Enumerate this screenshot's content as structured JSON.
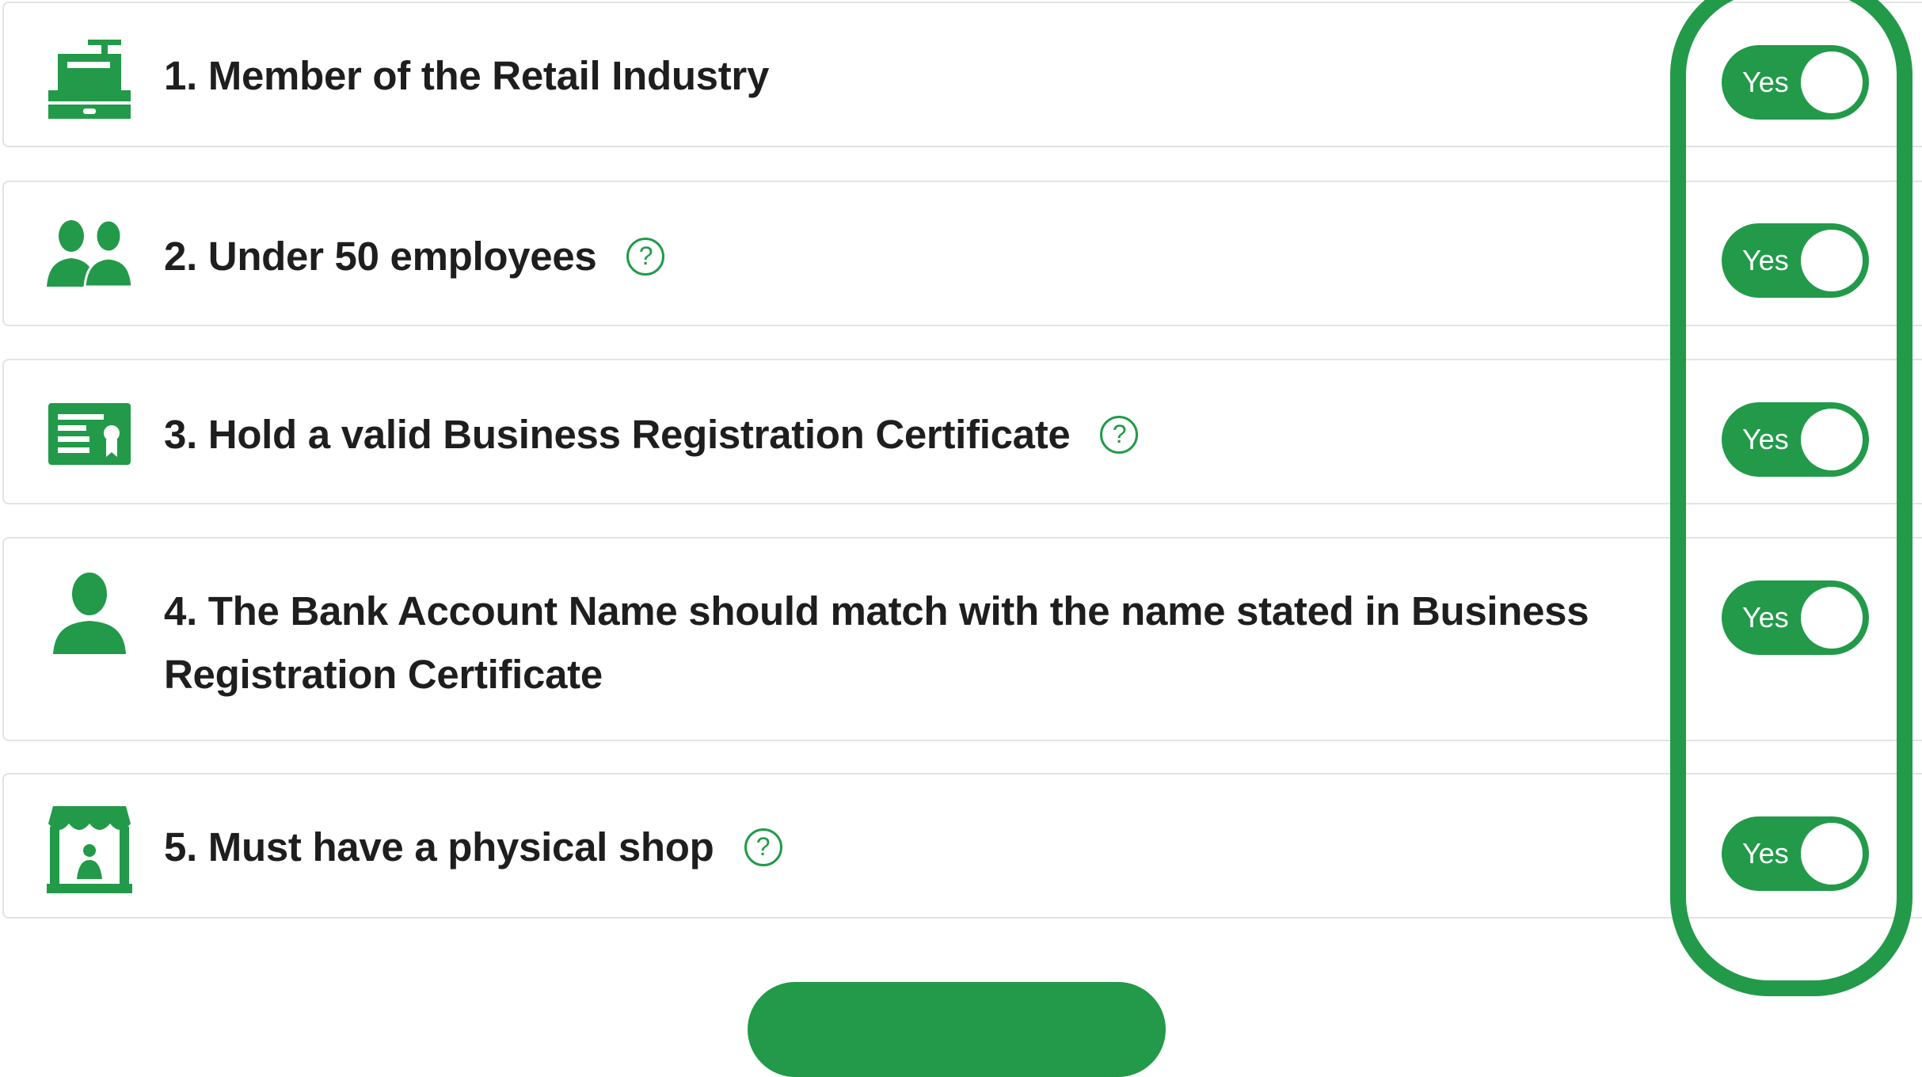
{
  "accent_color": "#229a49",
  "criteria": [
    {
      "icon": "cash-register-icon",
      "text": "1. Member of the Retail Industry",
      "has_help": false,
      "toggle_label": "Yes",
      "toggle_on": true
    },
    {
      "icon": "employees-icon",
      "text": "2. Under 50 employees",
      "has_help": true,
      "toggle_label": "Yes",
      "toggle_on": true
    },
    {
      "icon": "certificate-icon",
      "text": "3. Hold a valid Business Registration Certificate",
      "has_help": true,
      "toggle_label": "Yes",
      "toggle_on": true
    },
    {
      "icon": "person-icon",
      "text": "4. The Bank Account Name should match with the name stated in Business Registration Certificate",
      "text_line1": "4. The Bank Account Name should match with the name stated in Business",
      "text_line2": "Registration Certificate",
      "has_help": false,
      "toggle_label": "Yes",
      "toggle_on": true
    },
    {
      "icon": "shop-icon",
      "text": "5. Must have a physical shop",
      "has_help": true,
      "toggle_label": "Yes",
      "toggle_on": true
    }
  ],
  "help_glyph": "?"
}
